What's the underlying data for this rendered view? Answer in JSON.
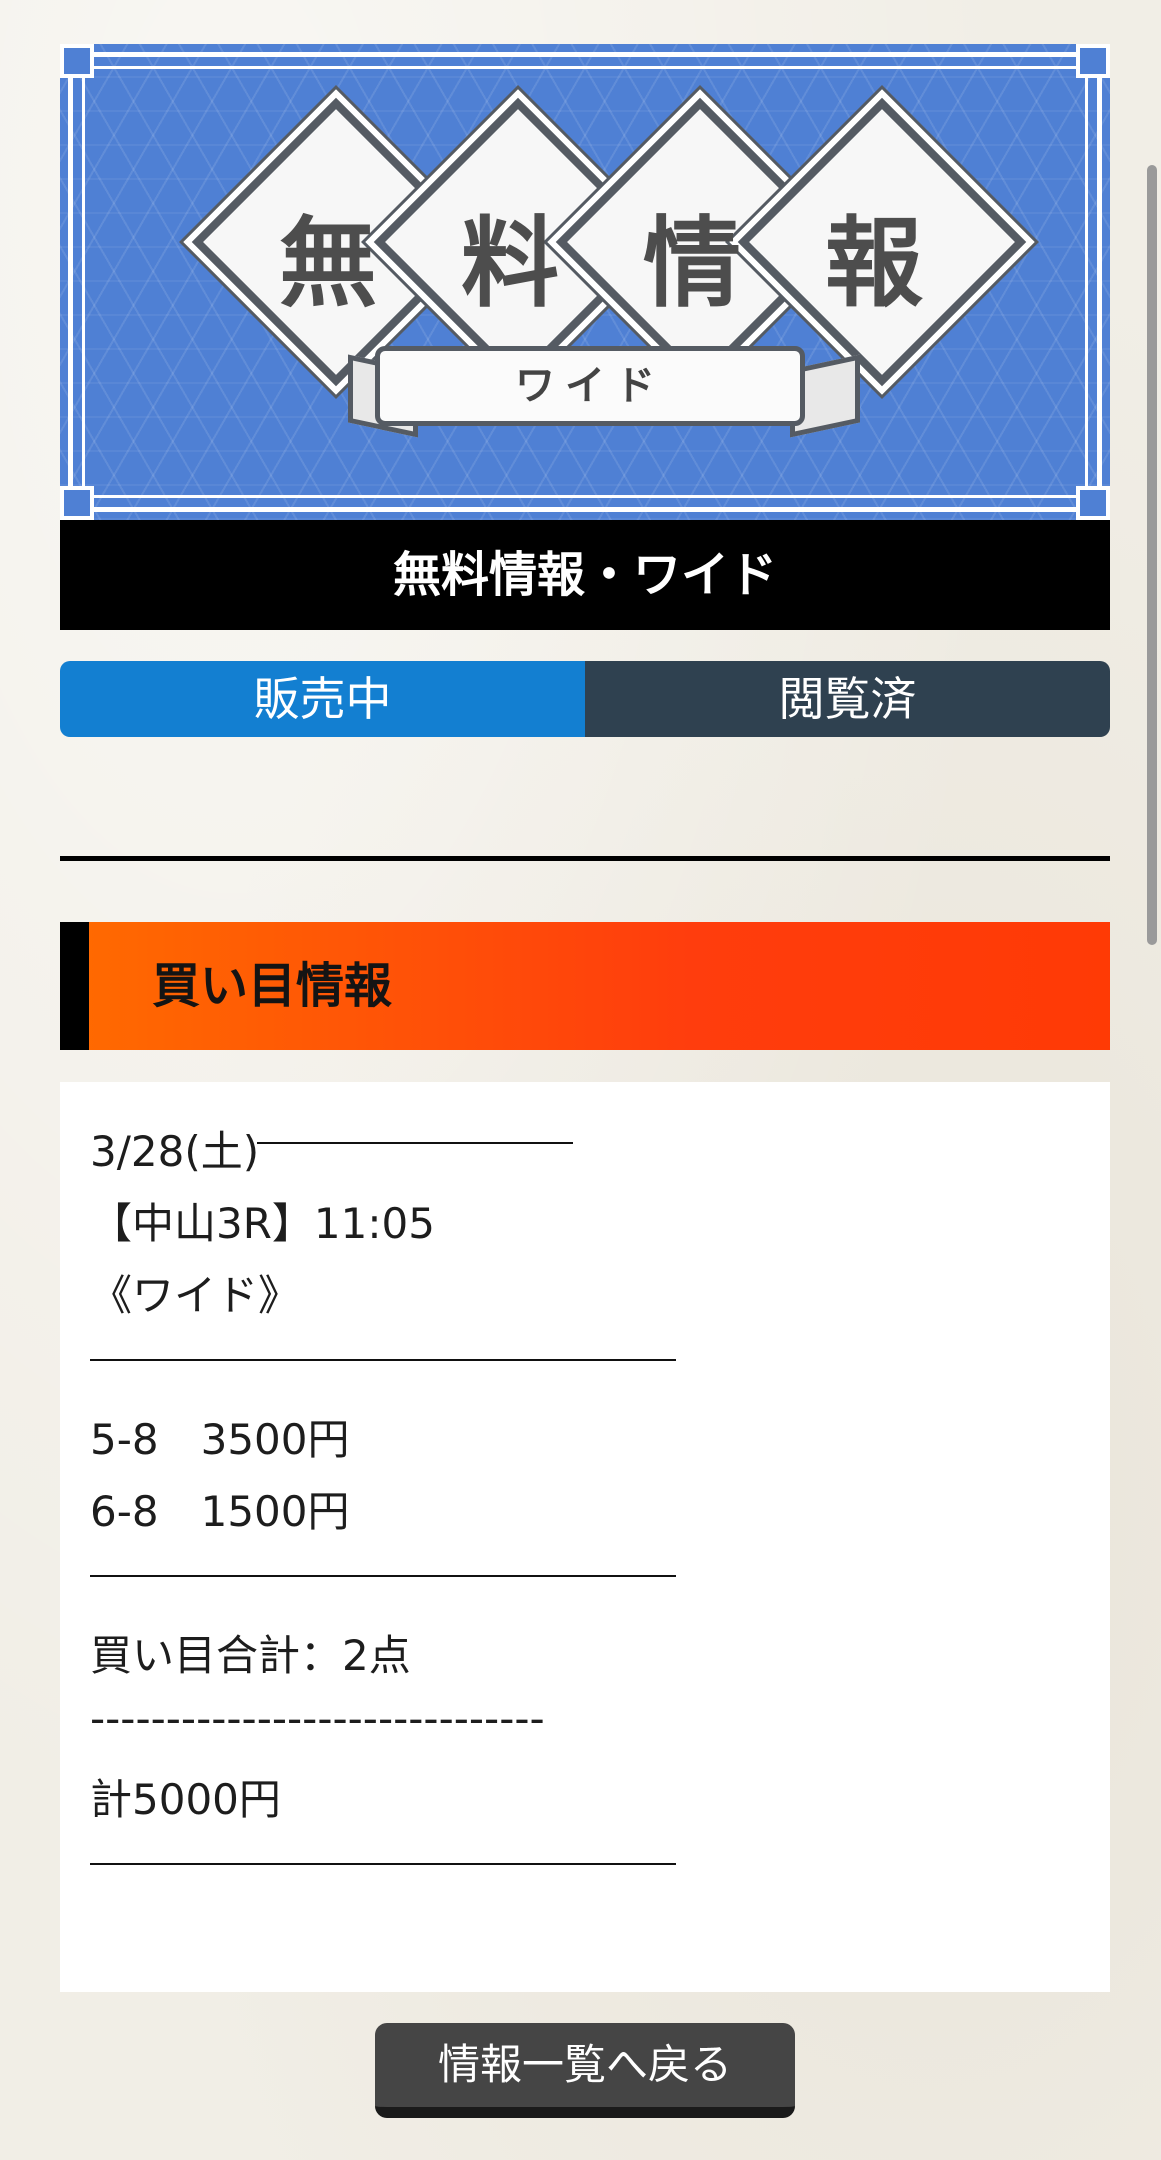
{
  "banner": {
    "chars": [
      "無",
      "料",
      "情",
      "報"
    ],
    "ribbon_text": "ワイド",
    "colors": {
      "background": "#4f80d4",
      "frame": "#ffffff"
    }
  },
  "title_bar": {
    "text": "無料情報・ワイド"
  },
  "tabs": [
    {
      "label": "販売中",
      "active": true,
      "color": "#137fd1"
    },
    {
      "label": "閲覧済",
      "active": false,
      "color": "#2f4150"
    }
  ],
  "section": {
    "title": "買い目情報",
    "accent": "#ff4a0a"
  },
  "content": {
    "date": "3/28(土)",
    "race": "【中山3R】11:05",
    "bet_type": "《ワイド》",
    "bets": [
      "5-8　3500円",
      "6-8　1500円"
    ],
    "total_points": "買い目合計：2点",
    "dashes": "------------------------------",
    "total_amount": "計5000円"
  },
  "back_button": {
    "label": "情報一覧へ戻る"
  }
}
